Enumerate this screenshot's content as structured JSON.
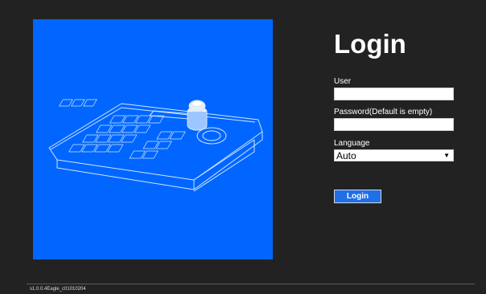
{
  "colors": {
    "background": "#222222",
    "hero": "#0066ff",
    "button": "#1f6fe6"
  },
  "hero": {
    "icon": "ptz-keyboard-controller-icon"
  },
  "login": {
    "title": "Login",
    "user_label": "User",
    "user_value": "",
    "password_label": "Password(Default is empty)",
    "password_value": "",
    "language_label": "Language",
    "language_selected": "Auto",
    "button_label": "Login"
  },
  "footer": {
    "version": "s1.0.0.4Eagle_c01010204"
  }
}
